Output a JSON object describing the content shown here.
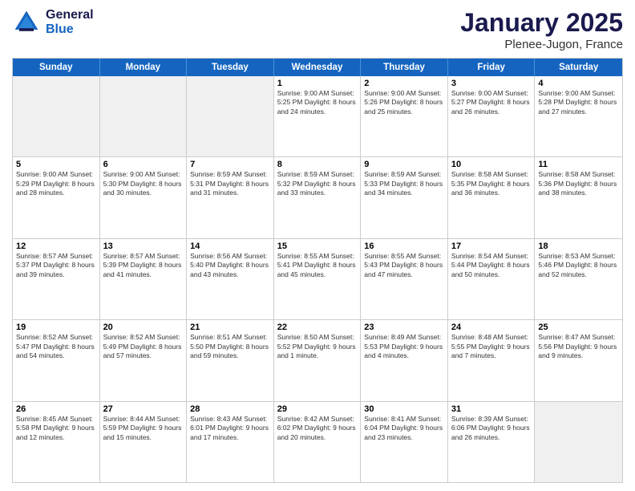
{
  "logo": {
    "general": "General",
    "blue": "Blue"
  },
  "title": {
    "month": "January 2025",
    "location": "Plenee-Jugon, France"
  },
  "header": {
    "days": [
      "Sunday",
      "Monday",
      "Tuesday",
      "Wednesday",
      "Thursday",
      "Friday",
      "Saturday"
    ]
  },
  "weeks": [
    [
      {
        "day": "",
        "info": "",
        "empty": true
      },
      {
        "day": "",
        "info": "",
        "empty": true
      },
      {
        "day": "",
        "info": "",
        "empty": true
      },
      {
        "day": "1",
        "info": "Sunrise: 9:00 AM\nSunset: 5:25 PM\nDaylight: 8 hours and 24 minutes."
      },
      {
        "day": "2",
        "info": "Sunrise: 9:00 AM\nSunset: 5:26 PM\nDaylight: 8 hours and 25 minutes."
      },
      {
        "day": "3",
        "info": "Sunrise: 9:00 AM\nSunset: 5:27 PM\nDaylight: 8 hours and 26 minutes."
      },
      {
        "day": "4",
        "info": "Sunrise: 9:00 AM\nSunset: 5:28 PM\nDaylight: 8 hours and 27 minutes."
      }
    ],
    [
      {
        "day": "5",
        "info": "Sunrise: 9:00 AM\nSunset: 5:29 PM\nDaylight: 8 hours and 28 minutes."
      },
      {
        "day": "6",
        "info": "Sunrise: 9:00 AM\nSunset: 5:30 PM\nDaylight: 8 hours and 30 minutes."
      },
      {
        "day": "7",
        "info": "Sunrise: 8:59 AM\nSunset: 5:31 PM\nDaylight: 8 hours and 31 minutes."
      },
      {
        "day": "8",
        "info": "Sunrise: 8:59 AM\nSunset: 5:32 PM\nDaylight: 8 hours and 33 minutes."
      },
      {
        "day": "9",
        "info": "Sunrise: 8:59 AM\nSunset: 5:33 PM\nDaylight: 8 hours and 34 minutes."
      },
      {
        "day": "10",
        "info": "Sunrise: 8:58 AM\nSunset: 5:35 PM\nDaylight: 8 hours and 36 minutes."
      },
      {
        "day": "11",
        "info": "Sunrise: 8:58 AM\nSunset: 5:36 PM\nDaylight: 8 hours and 38 minutes."
      }
    ],
    [
      {
        "day": "12",
        "info": "Sunrise: 8:57 AM\nSunset: 5:37 PM\nDaylight: 8 hours and 39 minutes."
      },
      {
        "day": "13",
        "info": "Sunrise: 8:57 AM\nSunset: 5:39 PM\nDaylight: 8 hours and 41 minutes."
      },
      {
        "day": "14",
        "info": "Sunrise: 8:56 AM\nSunset: 5:40 PM\nDaylight: 8 hours and 43 minutes."
      },
      {
        "day": "15",
        "info": "Sunrise: 8:55 AM\nSunset: 5:41 PM\nDaylight: 8 hours and 45 minutes."
      },
      {
        "day": "16",
        "info": "Sunrise: 8:55 AM\nSunset: 5:43 PM\nDaylight: 8 hours and 47 minutes."
      },
      {
        "day": "17",
        "info": "Sunrise: 8:54 AM\nSunset: 5:44 PM\nDaylight: 8 hours and 50 minutes."
      },
      {
        "day": "18",
        "info": "Sunrise: 8:53 AM\nSunset: 5:46 PM\nDaylight: 8 hours and 52 minutes."
      }
    ],
    [
      {
        "day": "19",
        "info": "Sunrise: 8:52 AM\nSunset: 5:47 PM\nDaylight: 8 hours and 54 minutes."
      },
      {
        "day": "20",
        "info": "Sunrise: 8:52 AM\nSunset: 5:49 PM\nDaylight: 8 hours and 57 minutes."
      },
      {
        "day": "21",
        "info": "Sunrise: 8:51 AM\nSunset: 5:50 PM\nDaylight: 8 hours and 59 minutes."
      },
      {
        "day": "22",
        "info": "Sunrise: 8:50 AM\nSunset: 5:52 PM\nDaylight: 9 hours and 1 minute."
      },
      {
        "day": "23",
        "info": "Sunrise: 8:49 AM\nSunset: 5:53 PM\nDaylight: 9 hours and 4 minutes."
      },
      {
        "day": "24",
        "info": "Sunrise: 8:48 AM\nSunset: 5:55 PM\nDaylight: 9 hours and 7 minutes."
      },
      {
        "day": "25",
        "info": "Sunrise: 8:47 AM\nSunset: 5:56 PM\nDaylight: 9 hours and 9 minutes."
      }
    ],
    [
      {
        "day": "26",
        "info": "Sunrise: 8:45 AM\nSunset: 5:58 PM\nDaylight: 9 hours and 12 minutes."
      },
      {
        "day": "27",
        "info": "Sunrise: 8:44 AM\nSunset: 5:59 PM\nDaylight: 9 hours and 15 minutes."
      },
      {
        "day": "28",
        "info": "Sunrise: 8:43 AM\nSunset: 6:01 PM\nDaylight: 9 hours and 17 minutes."
      },
      {
        "day": "29",
        "info": "Sunrise: 8:42 AM\nSunset: 6:02 PM\nDaylight: 9 hours and 20 minutes."
      },
      {
        "day": "30",
        "info": "Sunrise: 8:41 AM\nSunset: 6:04 PM\nDaylight: 9 hours and 23 minutes."
      },
      {
        "day": "31",
        "info": "Sunrise: 8:39 AM\nSunset: 6:06 PM\nDaylight: 9 hours and 26 minutes."
      },
      {
        "day": "",
        "info": "",
        "empty": true
      }
    ]
  ]
}
